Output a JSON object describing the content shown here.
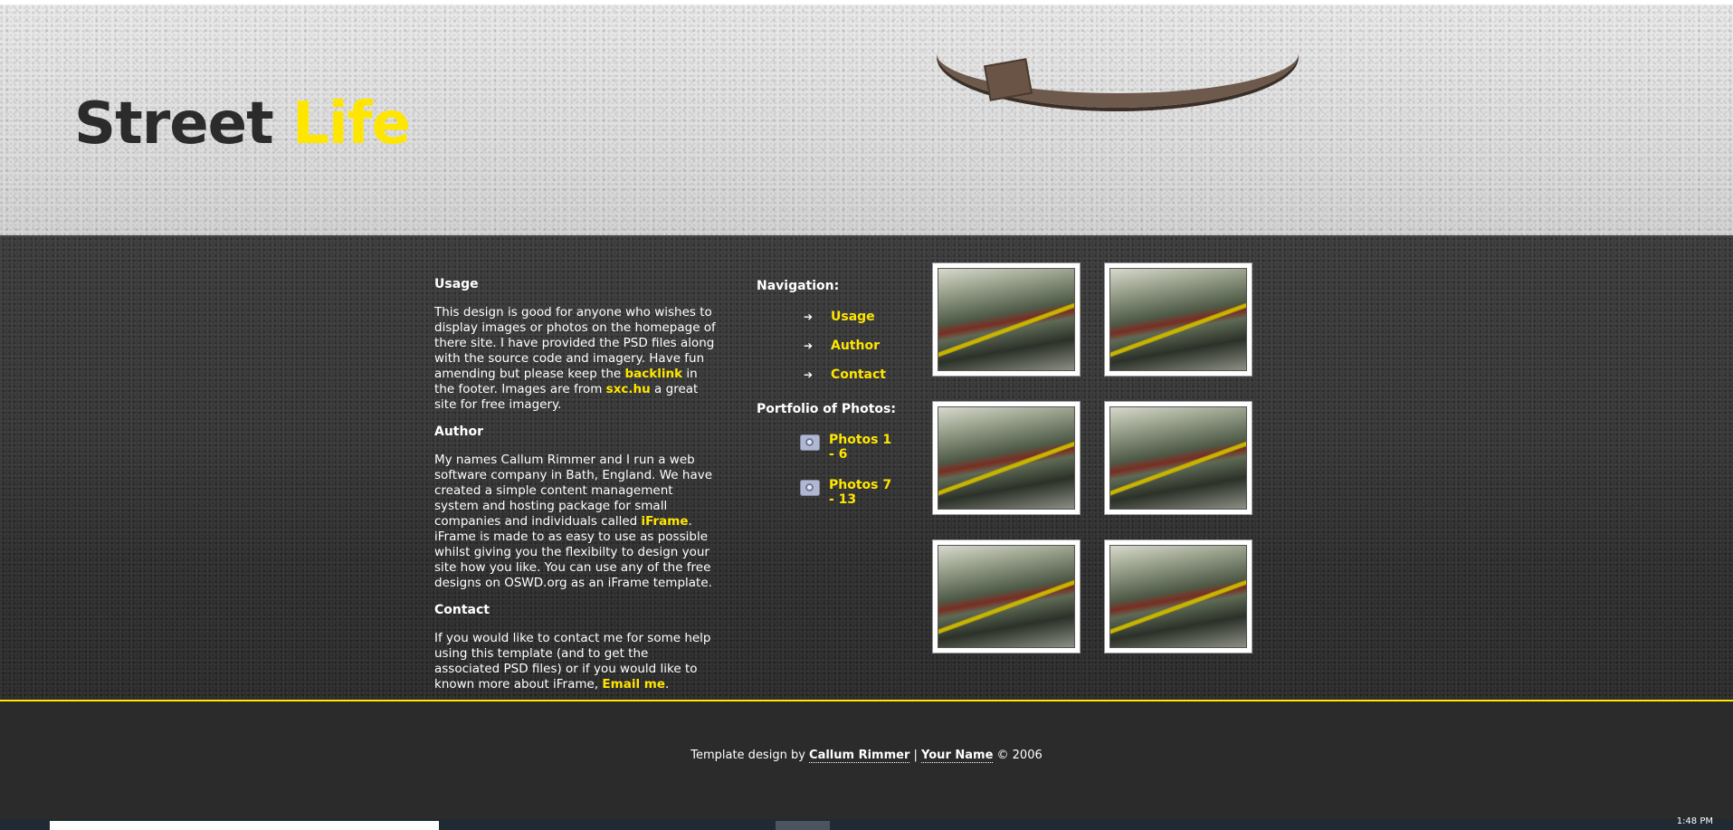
{
  "header": {
    "title_main": "Street",
    "title_accent": "Life"
  },
  "content": {
    "usage": {
      "heading": "Usage",
      "text_1": "This design is good for anyone who wishes to display images or photos on the homepage of there site. I have provided the PSD files along with the source code and imagery. Have fun amending but please keep the ",
      "link_backlink": "backlink",
      "text_2": " in the footer. Images are from ",
      "link_sxc": "sxc.hu",
      "text_3": " a great site for free imagery."
    },
    "author": {
      "heading": "Author",
      "text_1": "My names Callum Rimmer and I run a web software company in Bath, England. We have created a simple content management system and hosting package for small companies and individuals called ",
      "link_iframe": "iFrame",
      "text_2": ". iFrame is made to as easy to use as possible whilst giving you the flexibilty to design your site how you like. You can use any of the free designs on OSWD.org as an iFrame template."
    },
    "contact": {
      "heading": "Contact",
      "text_1": "If you would like to contact me for some help using this template (and to get the associated PSD files) or if you would like to known more about iFrame, ",
      "link_email": "Email me",
      "text_2": "."
    }
  },
  "navigation": {
    "heading": "Navigation:",
    "items": [
      {
        "label": "Usage",
        "icon": "arrow-right-icon"
      },
      {
        "label": "Author",
        "icon": "arrow-right-icon"
      },
      {
        "label": "Contact",
        "icon": "arrow-right-icon"
      }
    ]
  },
  "portfolio": {
    "heading": "Portfolio of Photos:",
    "items": [
      {
        "label": "Photos 1 - 6",
        "icon": "camera-icon"
      },
      {
        "label": "Photos 7 - 13",
        "icon": "camera-icon"
      }
    ]
  },
  "gallery": {
    "thumbnail_count": 6
  },
  "footer": {
    "prefix": "Template design by ",
    "link_author": "Callum Rimmer",
    "separator": " | ",
    "link_name": "Your Name",
    "suffix": " © 2006"
  },
  "taskbar": {
    "clock": "1:48 PM"
  },
  "colors": {
    "accent": "#ffe600",
    "background": "#2b2b2b",
    "text": "#ffffff"
  }
}
